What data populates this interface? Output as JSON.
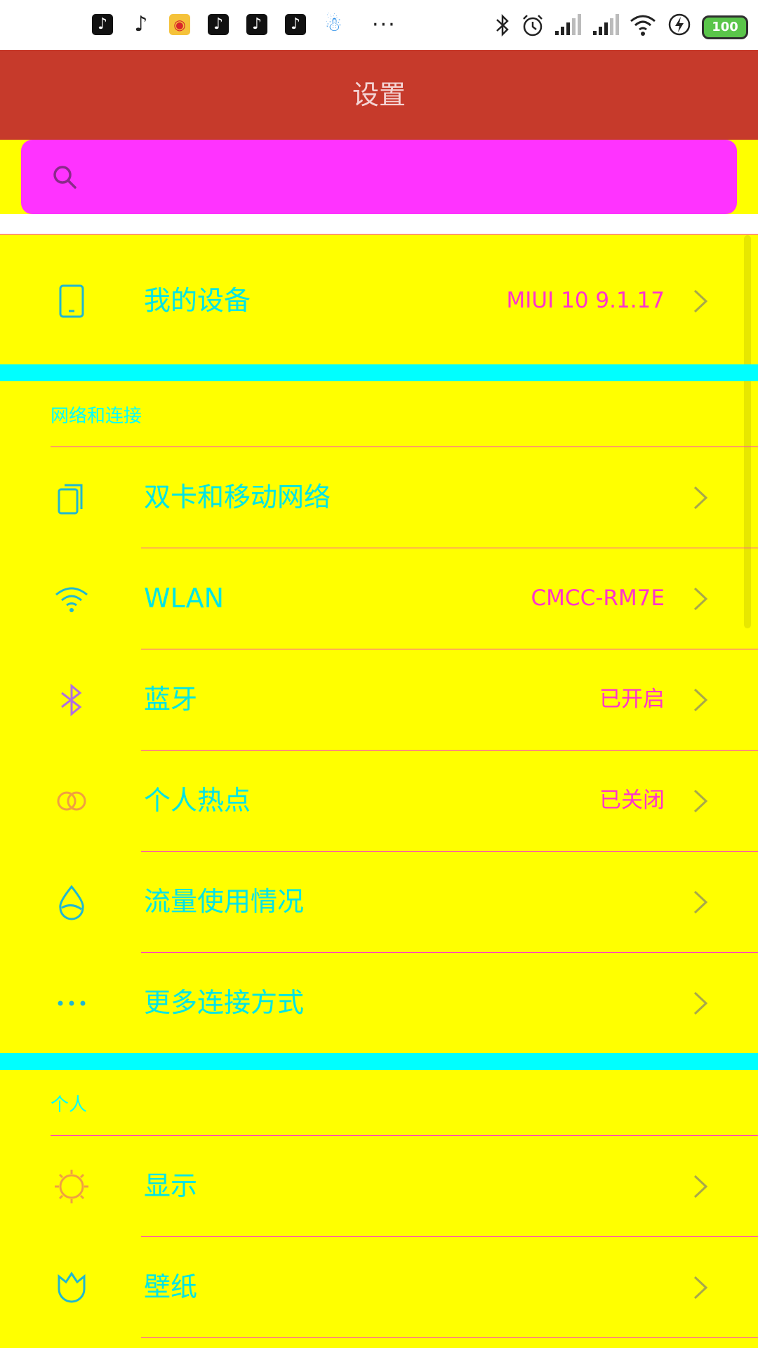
{
  "status_bar": {
    "more_dots": "···",
    "battery_level": "100",
    "icons": [
      "douyin-icon",
      "tiktok-note-icon",
      "weibo-icon",
      "douyin-icon",
      "douyin-icon",
      "douyin-icon",
      "qq-icon",
      "bluetooth-icon",
      "alarm-icon",
      "signal-icon",
      "signal-icon",
      "wifi-icon",
      "charging-icon",
      "battery-icon"
    ]
  },
  "header": {
    "title": "设置"
  },
  "search": {
    "placeholder": ""
  },
  "my_device": {
    "label": "我的设备",
    "value": "MIUI 10 9.1.17"
  },
  "sections": {
    "network": {
      "title": "网络和连接",
      "items": [
        {
          "label": "双卡和移动网络",
          "value": ""
        },
        {
          "label": "WLAN",
          "value": "CMCC-RM7E"
        },
        {
          "label": "蓝牙",
          "value": "已开启"
        },
        {
          "label": "个人热点",
          "value": "已关闭"
        },
        {
          "label": "流量使用情况",
          "value": ""
        },
        {
          "label": "更多连接方式",
          "value": ""
        }
      ]
    },
    "personal": {
      "title": "个人",
      "items": [
        {
          "label": "显示",
          "value": ""
        },
        {
          "label": "壁纸",
          "value": ""
        }
      ]
    }
  },
  "colors": {
    "header_bg": "#c63a2b",
    "search_bg": "#ff33ff",
    "list_bg": "#ffff00",
    "section_band": "#00ffff",
    "label_text": "#00e5e5",
    "value_text": "#ff33cc"
  }
}
